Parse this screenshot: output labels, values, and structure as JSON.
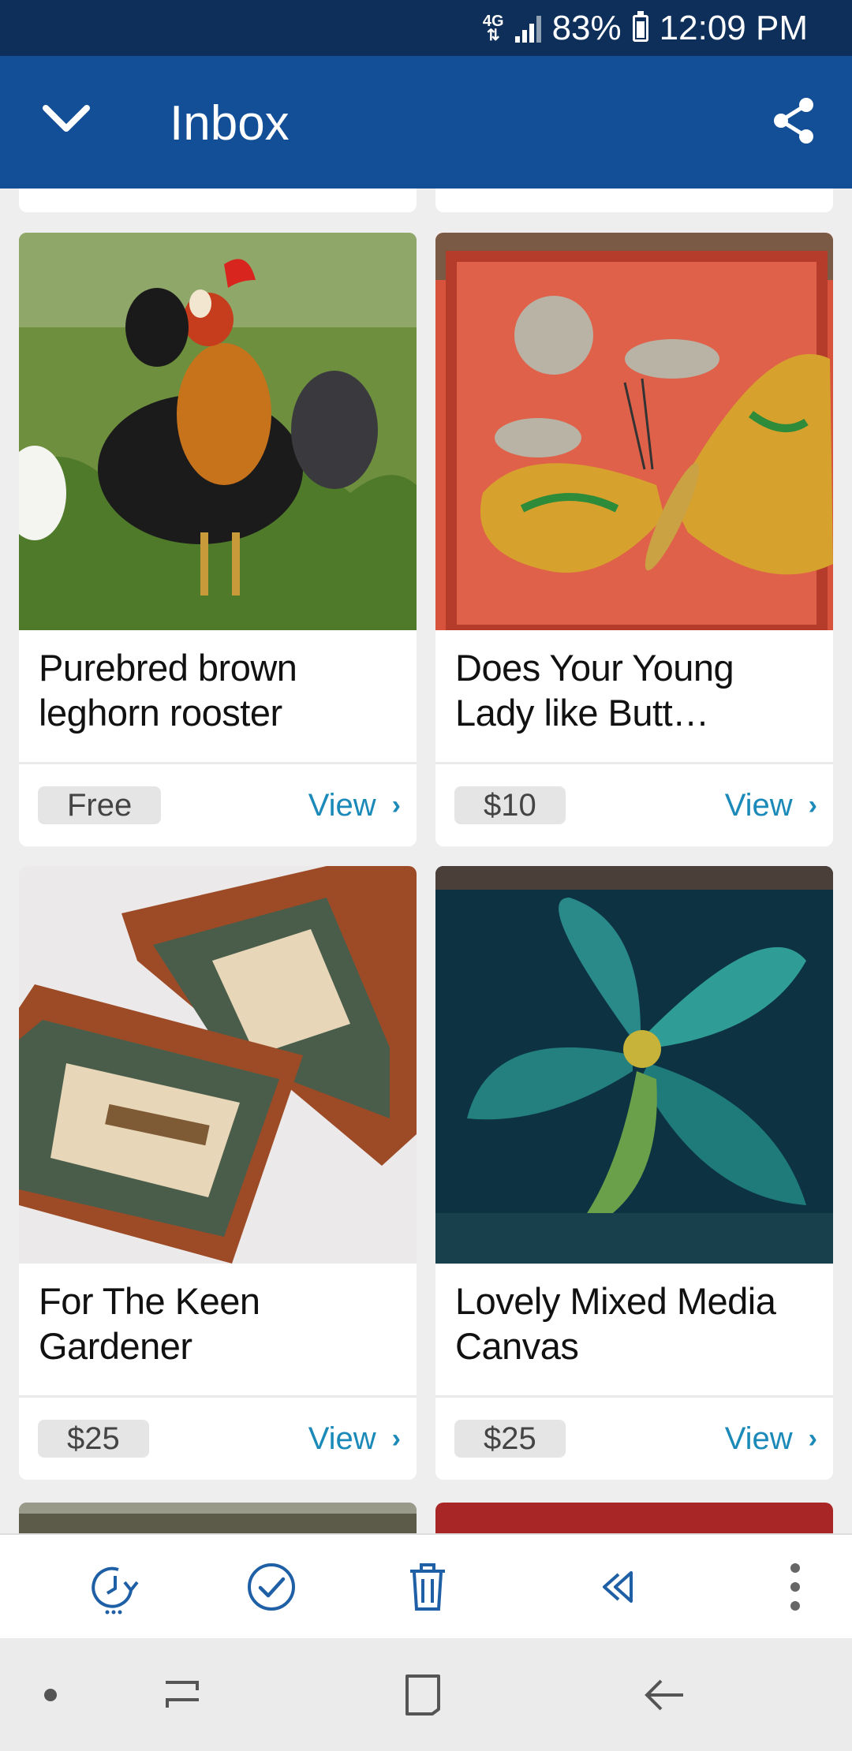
{
  "status_bar": {
    "network": "4G",
    "battery": "83%",
    "time": "12:09 PM",
    "icons": [
      "network-icon",
      "signal-icon",
      "battery-icon"
    ]
  },
  "app_bar": {
    "title": "Inbox",
    "icons": [
      "chevron-down-icon",
      "share-icon"
    ],
    "color": "#124f97"
  },
  "cards": [
    {
      "title": "Purebred brown leghorn rooster",
      "price": "Free",
      "view_label": "View",
      "image": "rooster-photo"
    },
    {
      "title": "Does Your Young Lady like Butt…",
      "price": "$10",
      "view_label": "View",
      "image": "butterfly-canvas-photo"
    },
    {
      "title": "For The Keen Gardener",
      "price": "$25",
      "view_label": "View",
      "image": "framed-prints-photo"
    },
    {
      "title": "Lovely Mixed Media Canvas",
      "price": "$25",
      "view_label": "View",
      "image": "flower-canvas-photo"
    }
  ],
  "action_bar": {
    "icons": [
      "snooze-icon",
      "mark-done-icon",
      "delete-icon",
      "reply-all-icon",
      "more-options-icon"
    ]
  },
  "nav_bar": {
    "icons": [
      "dot-icon",
      "recents-icon",
      "home-icon",
      "back-icon"
    ]
  },
  "colors": {
    "status_bar": "#0d2f5a",
    "accent_link": "#1b8ab8",
    "action_icon": "#1f5fa6"
  }
}
